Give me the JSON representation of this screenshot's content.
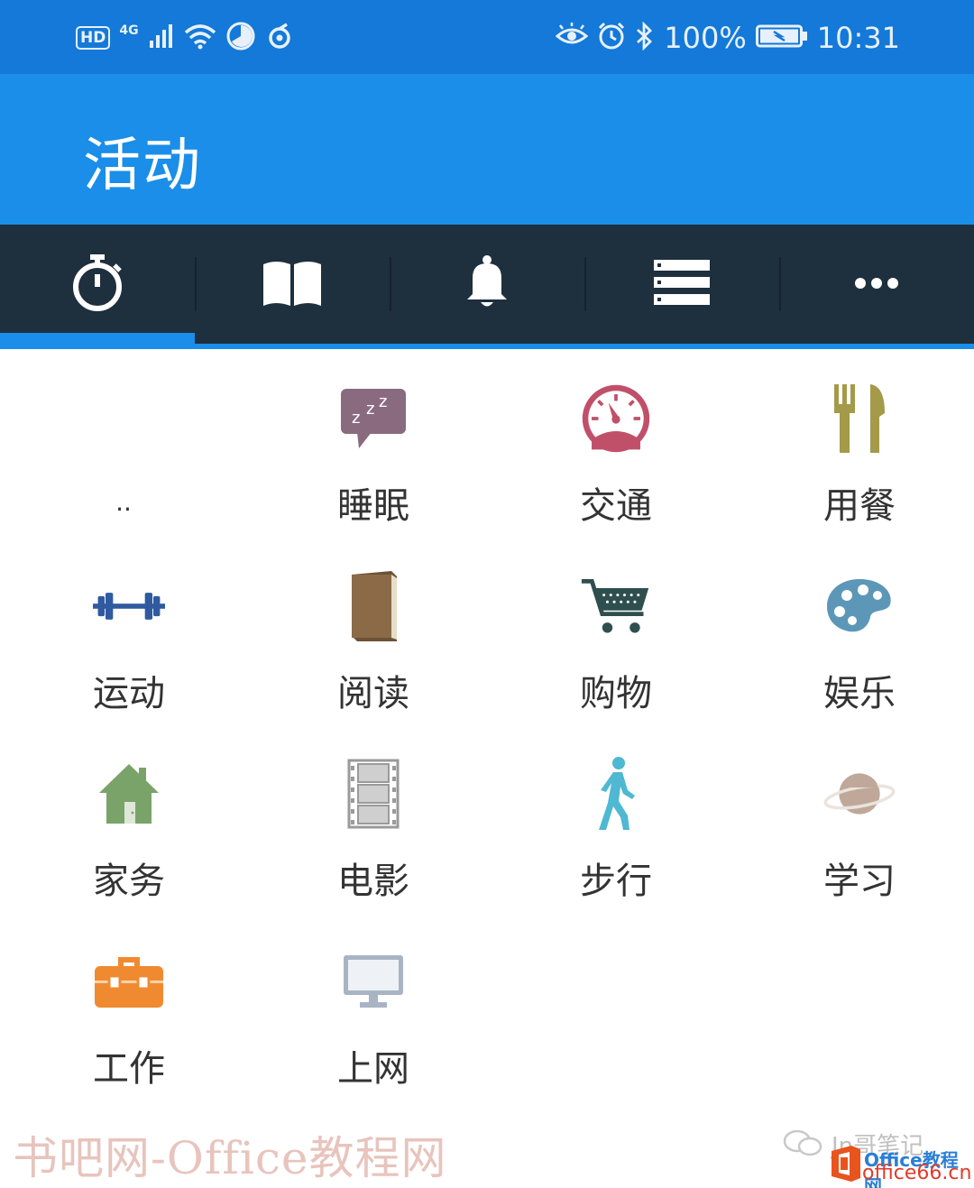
{
  "status_bar": {
    "hd": "HD",
    "network": "4G",
    "battery": "100%",
    "time": "10:31"
  },
  "app_bar": {
    "title": "活动"
  },
  "tabs": [
    {
      "icon": "stopwatch-icon",
      "active": true
    },
    {
      "icon": "book-open-icon",
      "active": false
    },
    {
      "icon": "bell-icon",
      "active": false
    },
    {
      "icon": "list-icon",
      "active": false
    },
    {
      "icon": "more-icon",
      "active": false
    }
  ],
  "activities": [
    {
      "label": "..",
      "icon": "none"
    },
    {
      "label": "睡眠",
      "icon": "sleep-bubble-icon",
      "color": "#8a6a7e"
    },
    {
      "label": "交通",
      "icon": "speedometer-icon",
      "color": "#c0506a"
    },
    {
      "label": "用餐",
      "icon": "fork-knife-icon",
      "color": "#a39a4a"
    },
    {
      "label": "运动",
      "icon": "dumbbell-icon",
      "color": "#2f5aa0"
    },
    {
      "label": "阅读",
      "icon": "book-icon",
      "color": "#8b6a48"
    },
    {
      "label": "购物",
      "icon": "shopping-cart-icon",
      "color": "#2f4f4f"
    },
    {
      "label": "娱乐",
      "icon": "palette-icon",
      "color": "#5d97b8"
    },
    {
      "label": "家务",
      "icon": "house-icon",
      "color": "#7aa36a"
    },
    {
      "label": "电影",
      "icon": "film-icon",
      "color": "#9a9a9a"
    },
    {
      "label": "步行",
      "icon": "walking-icon",
      "color": "#4fb8d2"
    },
    {
      "label": "学习",
      "icon": "planet-icon",
      "color": "#bfa89a"
    },
    {
      "label": "工作",
      "icon": "toolbox-icon",
      "color": "#f08a30"
    },
    {
      "label": "上网",
      "icon": "monitor-icon",
      "color": "#a8b4c4"
    }
  ],
  "watermark": {
    "left_text": "书吧网-Office教程网",
    "author": "Jn哥笔记",
    "site_name": "Office教程网",
    "site_url": "office66.cn"
  }
}
